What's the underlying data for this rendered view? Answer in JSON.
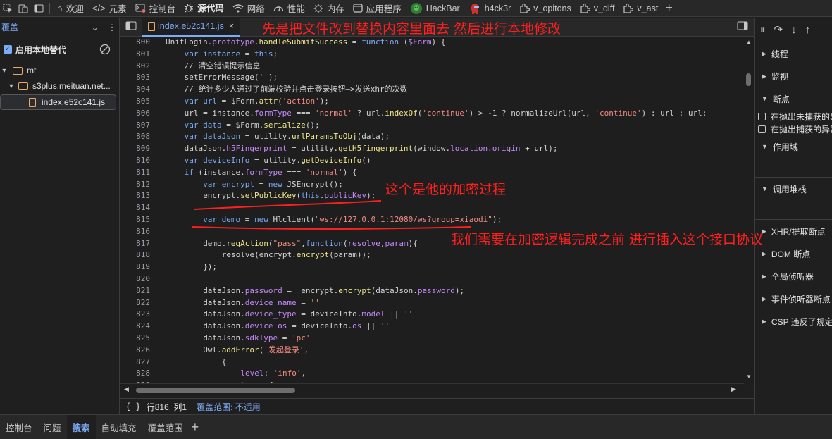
{
  "toolbar": {
    "tabs": [
      {
        "label": "欢迎",
        "icon": "home-icon"
      },
      {
        "label": "元素",
        "icon": "code-brackets-icon"
      },
      {
        "label": "控制台",
        "icon": "console-icon"
      },
      {
        "label": "源代码",
        "icon": "bug-icon"
      },
      {
        "label": "网络",
        "icon": "wifi-icon"
      },
      {
        "label": "性能",
        "icon": "gauge-icon"
      },
      {
        "label": "内存",
        "icon": "memory-icon"
      },
      {
        "label": "应用程序",
        "icon": "application-icon"
      },
      {
        "label": "HackBar",
        "icon": "hackbar-icon"
      },
      {
        "label": "h4ck3r",
        "icon": "h4ck3r-icon"
      },
      {
        "label": "v_opitons",
        "icon": "extension-icon"
      },
      {
        "label": "v_diff",
        "icon": "extension-icon"
      },
      {
        "label": "v_ast",
        "icon": "extension-icon"
      }
    ]
  },
  "left": {
    "title": "覆盖",
    "enable_label": "启用本地替代",
    "tree": {
      "root": "mt",
      "domain": "s3plus.meituan.net...",
      "file": "index.e52c141.js"
    }
  },
  "editor": {
    "file_tab": "index.e52c141.js",
    "lines": [
      {
        "n": "800",
        "d": 0,
        "h": "UnitLogin.<span class=\"p\">prototype</span>.<span class=\"f\">handleSubmitSuccess</span> = <span class=\"k\">function</span> (<span class=\"p\">$Form</span>) {"
      },
      {
        "n": "801",
        "d": 1,
        "h": "<span class=\"k\">var</span> <span class=\"k\">instance</span> = <span class=\"k\">this</span>;"
      },
      {
        "n": "802",
        "d": 1,
        "h": "// 清空错误提示信息"
      },
      {
        "n": "803",
        "d": 1,
        "h": "setErrorMessage(<span class=\"s\">''</span>);"
      },
      {
        "n": "804",
        "d": 1,
        "h": "// 统计多少人通过了前端校验并点击登录按钮—>发送xhr的次数"
      },
      {
        "n": "805",
        "d": 1,
        "h": "<span class=\"k\">var</span> <span class=\"k\">url</span> = $Form.<span class=\"f\">attr</span>(<span class=\"s\">'action'</span>);"
      },
      {
        "n": "806",
        "d": 1,
        "h": "url = instance.<span class=\"p\">formType</span> === <span class=\"s\">'normal'</span> ? url.<span class=\"f\">indexOf</span>(<span class=\"s\">'continue'</span>) > -1 ? normalizeUrl(url, <span class=\"s\">'continue'</span>) : url : url;"
      },
      {
        "n": "807",
        "d": 1,
        "h": "<span class=\"k\">var</span> <span class=\"k\">data</span> = $Form.<span class=\"f\">serialize</span>();"
      },
      {
        "n": "808",
        "d": 1,
        "h": "<span class=\"k\">var</span> <span class=\"k\">dataJson</span> = utility.<span class=\"f\">urlParamsToObj</span>(data);"
      },
      {
        "n": "809",
        "d": 1,
        "h": "dataJson.<span class=\"p\">h5Fingerprint</span> = utility.<span class=\"f\">getH5fingerprint</span>(window.<span class=\"p\">location</span>.<span class=\"p\">origin</span> + url);"
      },
      {
        "n": "810",
        "d": 1,
        "h": "<span class=\"k\">var</span> <span class=\"k\">deviceInfo</span> = utility.<span class=\"f\">getDeviceInfo</span>()"
      },
      {
        "n": "811",
        "d": 1,
        "h": "<span class=\"k\">if</span> (instance.<span class=\"p\">formType</span> === <span class=\"s\">'normal'</span>) {"
      },
      {
        "n": "812",
        "d": 2,
        "h": "<span class=\"k\">var</span> <span class=\"k\">encrypt</span> = <span class=\"k\">new</span> JSEncrypt();"
      },
      {
        "n": "813",
        "d": 2,
        "h": "encrypt.<span class=\"f\">setPublicKey</span>(<span class=\"k\">this</span>.<span class=\"p\">publicKey</span>);"
      },
      {
        "n": "814",
        "d": 2,
        "h": ""
      },
      {
        "n": "815",
        "d": 2,
        "h": "<span class=\"k\">var</span> <span class=\"k\">demo</span> = <span class=\"k\">new</span> Hlclient(<span class=\"s\">\"ws://127.0.0.1:12080/ws?group=xiaodi\"</span>);"
      },
      {
        "n": "816",
        "d": 2,
        "h": ""
      },
      {
        "n": "817",
        "d": 2,
        "h": "demo.<span class=\"f\">regAction</span>(<span class=\"s\">\"pass\"</span>,<span class=\"k\">function</span>(<span class=\"p\">resolve</span>,<span class=\"p\">param</span>){"
      },
      {
        "n": "818",
        "d": 3,
        "h": "resolve(encrypt.<span class=\"f\">encrypt</span>(param));"
      },
      {
        "n": "819",
        "d": 2,
        "h": "});"
      },
      {
        "n": "820",
        "d": 2,
        "h": ""
      },
      {
        "n": "821",
        "d": 2,
        "h": "dataJson.<span class=\"p\">password</span> =  encrypt.<span class=\"f\">encrypt</span>(dataJson.<span class=\"p\">password</span>);"
      },
      {
        "n": "822",
        "d": 2,
        "h": "dataJson.<span class=\"p\">device_name</span> = <span class=\"s\">''</span>"
      },
      {
        "n": "823",
        "d": 2,
        "h": "dataJson.<span class=\"p\">device_type</span> = deviceInfo.<span class=\"p\">model</span> || <span class=\"s\">''</span>"
      },
      {
        "n": "824",
        "d": 2,
        "h": "dataJson.<span class=\"p\">device_os</span> = deviceInfo.<span class=\"p\">os</span> || <span class=\"s\">''</span>"
      },
      {
        "n": "825",
        "d": 2,
        "h": "dataJson.<span class=\"p\">sdkType</span> = <span class=\"s\">'pc'</span>"
      },
      {
        "n": "826",
        "d": 2,
        "h": "Owl.<span class=\"f\">addError</span>(<span class=\"s\">'发起登录'</span>,"
      },
      {
        "n": "827",
        "d": 3,
        "h": "{"
      },
      {
        "n": "828",
        "d": 4,
        "h": "<span class=\"p\">level</span>: <span class=\"s\">'info'</span>,"
      },
      {
        "n": "829",
        "d": 4,
        "h": "<span class=\"p\">tags</span>: {"
      }
    ]
  },
  "status": {
    "braces": "{ }",
    "position": "行816, 列1",
    "coverage": "覆盖范围: 不适用"
  },
  "right": {
    "sections": [
      "线程",
      "监视",
      "断点"
    ],
    "checkboxes": [
      "在抛出未捕获的异常",
      "在抛出捕获的异常"
    ],
    "sections2": [
      "作用域"
    ],
    "sections3": [
      "调用堆栈"
    ],
    "sections4": [
      "XHR/提取断点",
      "DOM 断点",
      "全局侦听器",
      "事件侦听器断点",
      "CSP 违反了规定断点"
    ]
  },
  "drawer": {
    "tabs": [
      "控制台",
      "问题",
      "搜索",
      "自动填充",
      "覆盖范围"
    ],
    "active": "搜索"
  },
  "annotations": {
    "top": "先是把文件改到替换内容里面去 然后进行本地修改",
    "encrypt": "这个是他的加密过程",
    "insert": "我们需要在加密逻辑完成之前 进行插入这个接口协议"
  },
  "colors": {
    "accent": "#7cacf8",
    "annotation": "#ff1f1f"
  }
}
